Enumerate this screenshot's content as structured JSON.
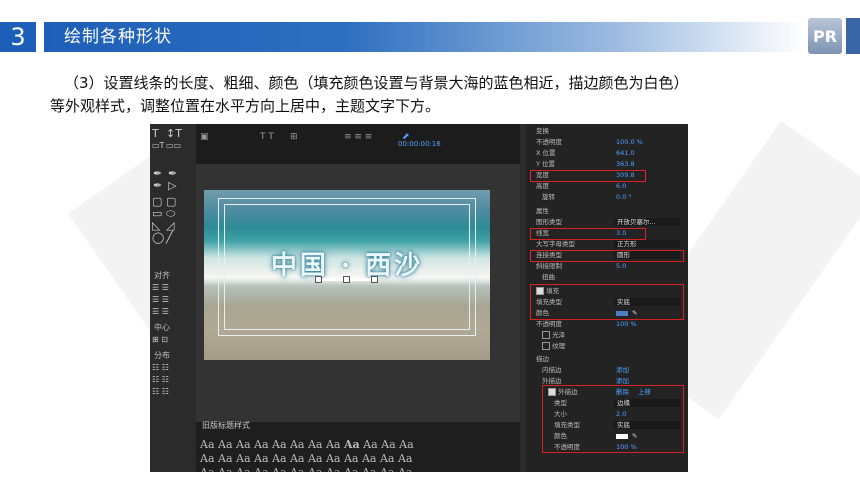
{
  "header": {
    "number": "3",
    "title": "绘制各种形状",
    "logo": "PR"
  },
  "intro": {
    "line1": "（3）设置线条的长度、粗细、颜色（填充颜色设置与背景大海的蓝色相近，描边颜色为白色）",
    "line2": "等外观样式，调整位置在水平方向上居中，主题文字下方。"
  },
  "editor": {
    "timecode": "00:00:00:16",
    "preview_title": "中国 · 西沙",
    "styles_label": "旧版标题样式",
    "align_label": "对齐",
    "center_label": "中心",
    "distribute_label": "分布"
  },
  "props": {
    "transform": "变换",
    "opacity": "不透明度",
    "opacity_v": "100.0 %",
    "xpos": "X 位置",
    "xpos_v": "641.0",
    "ypos": "Y 位置",
    "ypos_v": "363.8",
    "width": "宽度",
    "width_v": "309.8",
    "height": "高度",
    "height_v": "6.0",
    "rotation": "旋转",
    "rotation_v": "0.0 °",
    "attrs": "属性",
    "shape_type": "图形类型",
    "shape_type_v": "开放贝塞尔...",
    "line_width": "线宽",
    "line_width_v": "3.0",
    "cap_type": "大写字母类型",
    "cap_type_v": "正方形",
    "join_type": "连接类型",
    "join_type_v": "圆形",
    "miter": "斜接限制",
    "miter_v": "5.0",
    "distort": "扭曲",
    "fill": "填充",
    "fill_type": "填充类型",
    "fill_type_v": "实底",
    "color": "颜色",
    "opacity2": "不透明度",
    "opacity2_v": "100 %",
    "sheen": "光泽",
    "texture": "纹理",
    "stroke": "描边",
    "inner_stroke": "内描边",
    "add": "添加",
    "outer_stroke": "外描边",
    "add2": "添加",
    "outer_stroke_item": "外描边",
    "delete": "删除",
    "move_up": "上移",
    "type": "类型",
    "type_v": "边缘",
    "size": "大小",
    "size_v": "2.0",
    "fill_type2": "填充类型",
    "fill_type2_v": "实底",
    "color2": "颜色",
    "opacity3": "不透明度",
    "opacity3_v": "100 %"
  },
  "colors": {
    "accent": "#1d5fb8",
    "highlight": "#d62222",
    "value_blue": "#4da3ff"
  }
}
